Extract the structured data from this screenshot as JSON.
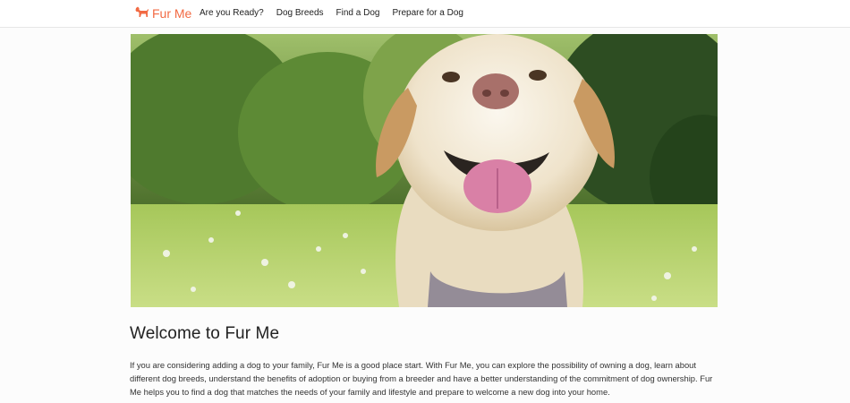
{
  "brand": {
    "name": "Fur Me",
    "icon": "dog-icon",
    "color": "#f26a43"
  },
  "nav": {
    "items": [
      {
        "label": "Are you Ready?"
      },
      {
        "label": "Dog Breeds"
      },
      {
        "label": "Find a Dog"
      },
      {
        "label": "Prepare for a Dog"
      }
    ]
  },
  "hero": {
    "image": "smiling-labrador-photo"
  },
  "main": {
    "title": "Welcome to Fur Me",
    "intro": "If you are considering adding a dog to your family, Fur Me is a good place start. With Fur Me, you can explore the possibility of owning a dog, learn about different dog breeds, understand the benefits of adoption or buying from a breeder and have a better understanding of the commitment of dog ownership. Fur Me helps you to find a dog that matches the needs of your family and lifestyle and prepare to welcome a new dog into your home."
  }
}
